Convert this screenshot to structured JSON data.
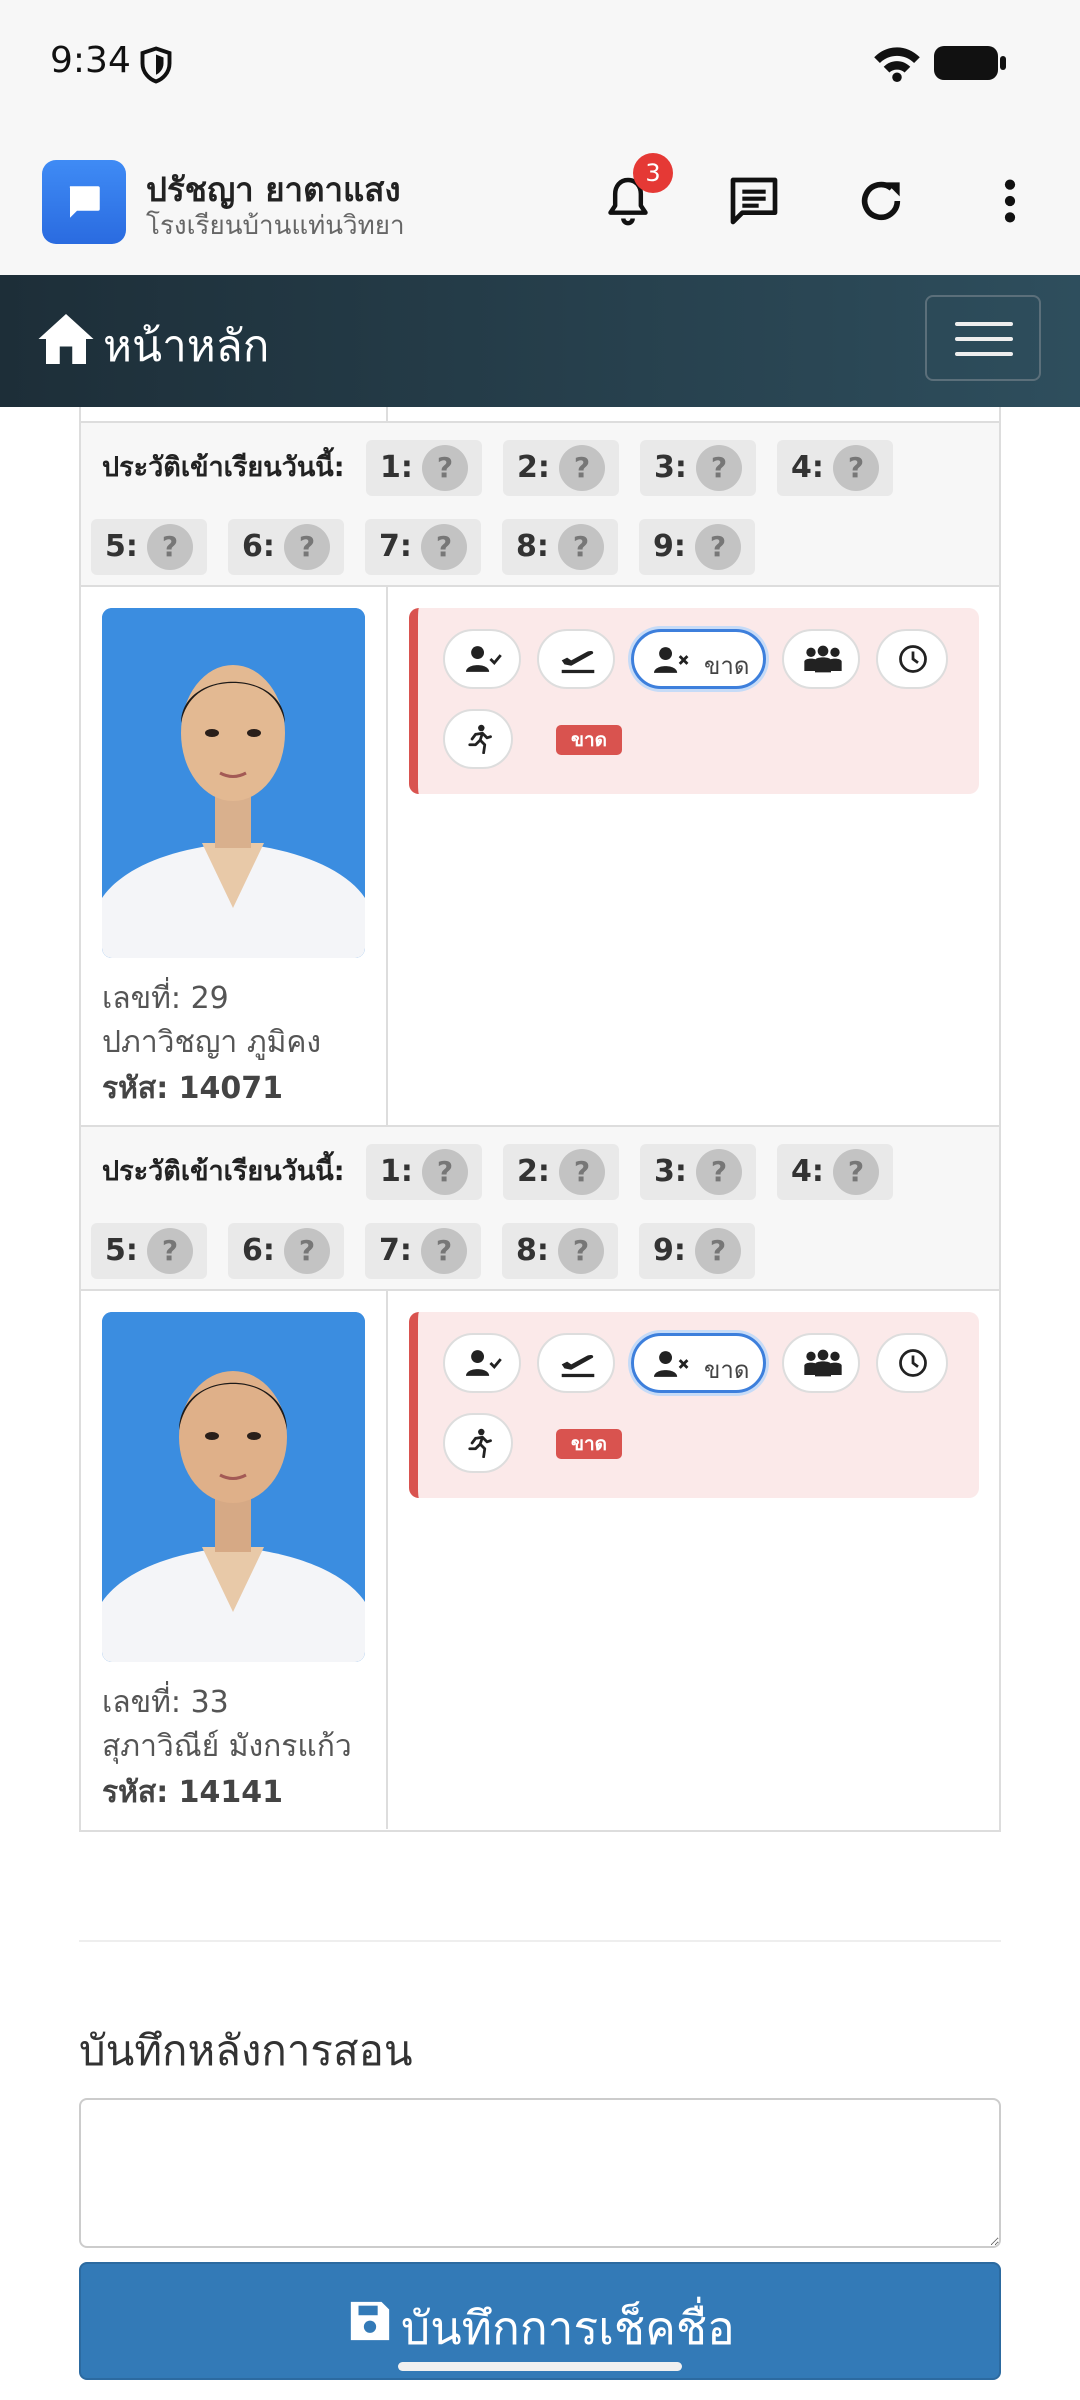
{
  "status_bar": {
    "time": "9:34"
  },
  "header": {
    "user_name": "ปรัชญา ยาตาแสง",
    "school": "โรงเรียนบ้านแท่นวิทยา",
    "notification_count": "3"
  },
  "nav": {
    "title": "หน้าหลัก"
  },
  "history": {
    "label": "ประวัติเข้าเรียนวันนี้:",
    "periods": [
      {
        "num": "1:",
        "status": "?"
      },
      {
        "num": "2:",
        "status": "?"
      },
      {
        "num": "3:",
        "status": "?"
      },
      {
        "num": "4:",
        "status": "?"
      },
      {
        "num": "5:",
        "status": "?"
      },
      {
        "num": "6:",
        "status": "?"
      },
      {
        "num": "7:",
        "status": "?"
      },
      {
        "num": "8:",
        "status": "?"
      },
      {
        "num": "9:",
        "status": "?"
      }
    ]
  },
  "students": [
    {
      "number": "เลขที่: 29",
      "name": "ปภาวิชญา ภูมิคง",
      "code": "รหัส: 14071",
      "selected_status": "ขาด",
      "status_tag": "ขาด"
    },
    {
      "number": "เลขที่: 33",
      "name": "สุภาวิณีย์ มังกรแก้ว",
      "code": "รหัส: 14141",
      "selected_status": "ขาด",
      "status_tag": "ขาด"
    }
  ],
  "note": {
    "label": "บันทึกหลังการสอน",
    "value": ""
  },
  "save_button": {
    "label": "บันทึกการเช็คชื่อ"
  },
  "colors": {
    "primary": "#337ab7",
    "absent": "#d9534f",
    "navbar": "#1d2e38",
    "card_bg": "#fbe9e9"
  }
}
